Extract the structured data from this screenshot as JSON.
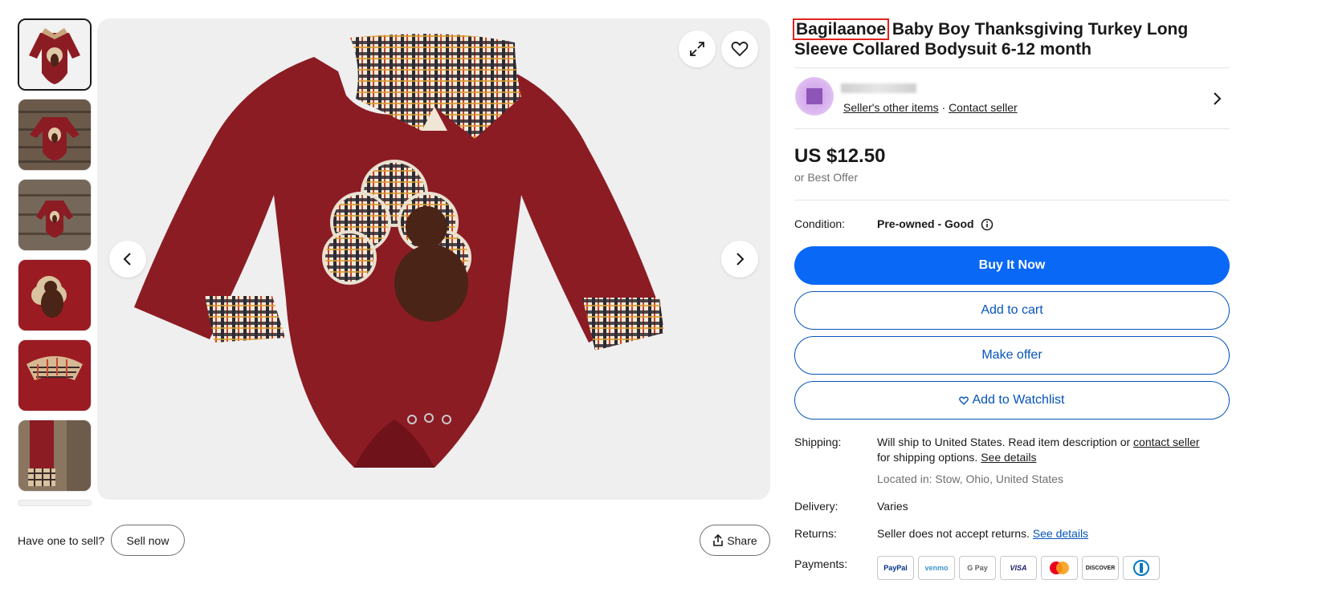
{
  "title": {
    "brand": "Bagilaanoe",
    "rest": " Baby Boy Thanksgiving Turkey Long Sleeve Collared Bodysuit 6-12 month"
  },
  "seller": {
    "other_items": "Seller's other items",
    "separator": "·",
    "contact": "Contact seller"
  },
  "price": {
    "amount": "US $12.50",
    "best_offer": "or Best Offer"
  },
  "condition": {
    "label": "Condition:",
    "value": "Pre-owned - Good"
  },
  "buttons": {
    "buy": "Buy It Now",
    "cart": "Add to cart",
    "offer": "Make offer",
    "watch": "Add to Watchlist"
  },
  "shipping": {
    "label": "Shipping:",
    "line1": "Will ship to United States. Read item description or ",
    "contact_link": "contact seller",
    "line2": "for shipping options. ",
    "details_link": "See details",
    "located": "Located in: Stow, Ohio, United States"
  },
  "delivery": {
    "label": "Delivery:",
    "value": "Varies"
  },
  "returns": {
    "label": "Returns:",
    "value": "Seller does not accept returns. ",
    "details_link": "See details"
  },
  "payments": {
    "label": "Payments:",
    "methods": [
      "PayPal",
      "venmo",
      "G Pay",
      "VISA",
      "Mastercard",
      "DISCOVER",
      "Diners"
    ]
  },
  "footer": {
    "have_one": "Have one to sell?",
    "sell_now": "Sell now",
    "share": "Share"
  },
  "colors": {
    "accent": "#0968f6",
    "link": "#0654ba",
    "garment": "#8b1c24",
    "highlight": "#e0241c"
  }
}
